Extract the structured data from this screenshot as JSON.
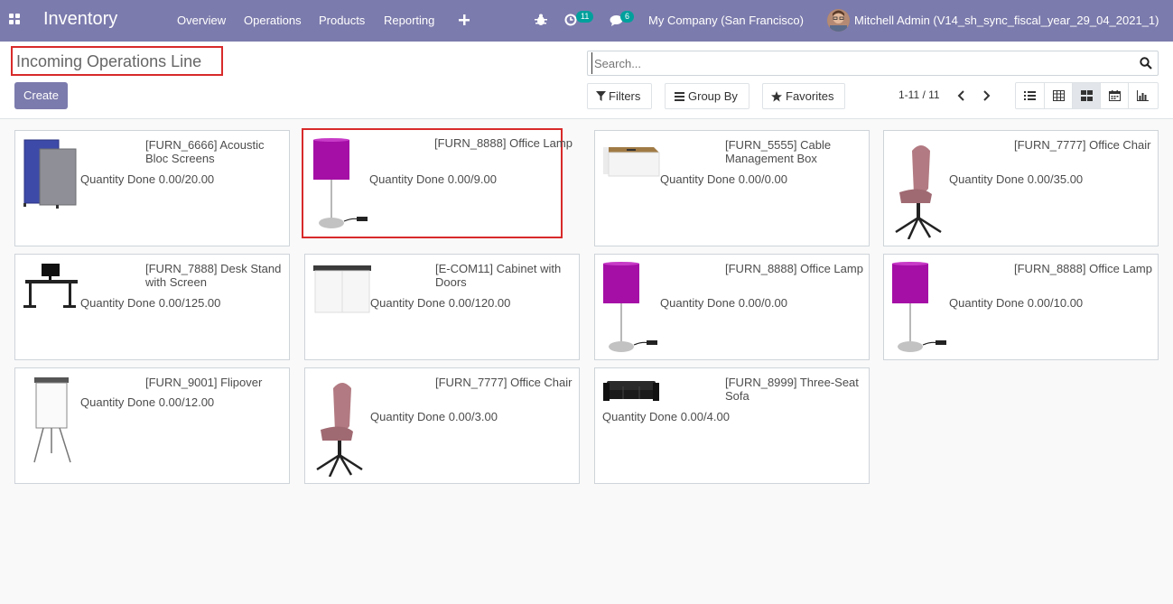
{
  "navbar": {
    "brand": "Inventory",
    "menu": [
      "Overview",
      "Operations",
      "Products",
      "Reporting"
    ],
    "activity_count": "11",
    "message_count": "6",
    "company": "My Company (San Francisco)",
    "user": "Mitchell Admin (V14_sh_sync_fiscal_year_29_04_2021_1)"
  },
  "control": {
    "title": "Incoming Operations Line",
    "create_label": "Create",
    "search_placeholder": "Search...",
    "filters_label": "Filters",
    "groupby_label": "Group By",
    "favorites_label": "Favorites",
    "pager": "1-11 / 11"
  },
  "cards": [
    {
      "title": "[FURN_6666] Acoustic Bloc Screens",
      "qty": "Quantity Done 0.00/20.00",
      "image": "acoustic-screen"
    },
    {
      "title": "[FURN_8888] Office Lamp",
      "qty": "Quantity Done 0.00/9.00",
      "image": "lamp"
    },
    {
      "title": "[FURN_5555] Cable Management Box",
      "qty": "Quantity Done 0.00/0.00",
      "image": "cable-box"
    },
    {
      "title": "[FURN_7777] Office Chair",
      "qty": "Quantity Done 0.00/35.00",
      "image": "chair"
    },
    {
      "title": "[FURN_7888] Desk Stand with Screen",
      "qty": "Quantity Done 0.00/125.00",
      "image": "desk"
    },
    {
      "title": "[E-COM11] Cabinet with Doors",
      "qty": "Quantity Done 0.00/120.00",
      "image": "cabinet"
    },
    {
      "title": "[FURN_8888] Office Lamp",
      "qty": "Quantity Done 0.00/0.00",
      "image": "lamp"
    },
    {
      "title": "[FURN_8888] Office Lamp",
      "qty": "Quantity Done 0.00/10.00",
      "image": "lamp"
    },
    {
      "title": "[FURN_9001] Flipover",
      "qty": "Quantity Done 0.00/12.00",
      "image": "flipover"
    },
    {
      "title": "[FURN_7777] Office Chair",
      "qty": "Quantity Done 0.00/3.00",
      "image": "chair"
    },
    {
      "title": "[FURN_8999] Three-Seat Sofa",
      "qty": "Quantity Done 0.00/4.00",
      "image": "sofa"
    }
  ],
  "colors": {
    "brand": "#7c7bad",
    "badge": "#00a09d",
    "highlight": "#d82a2a",
    "lamp": "#a50fa6"
  }
}
